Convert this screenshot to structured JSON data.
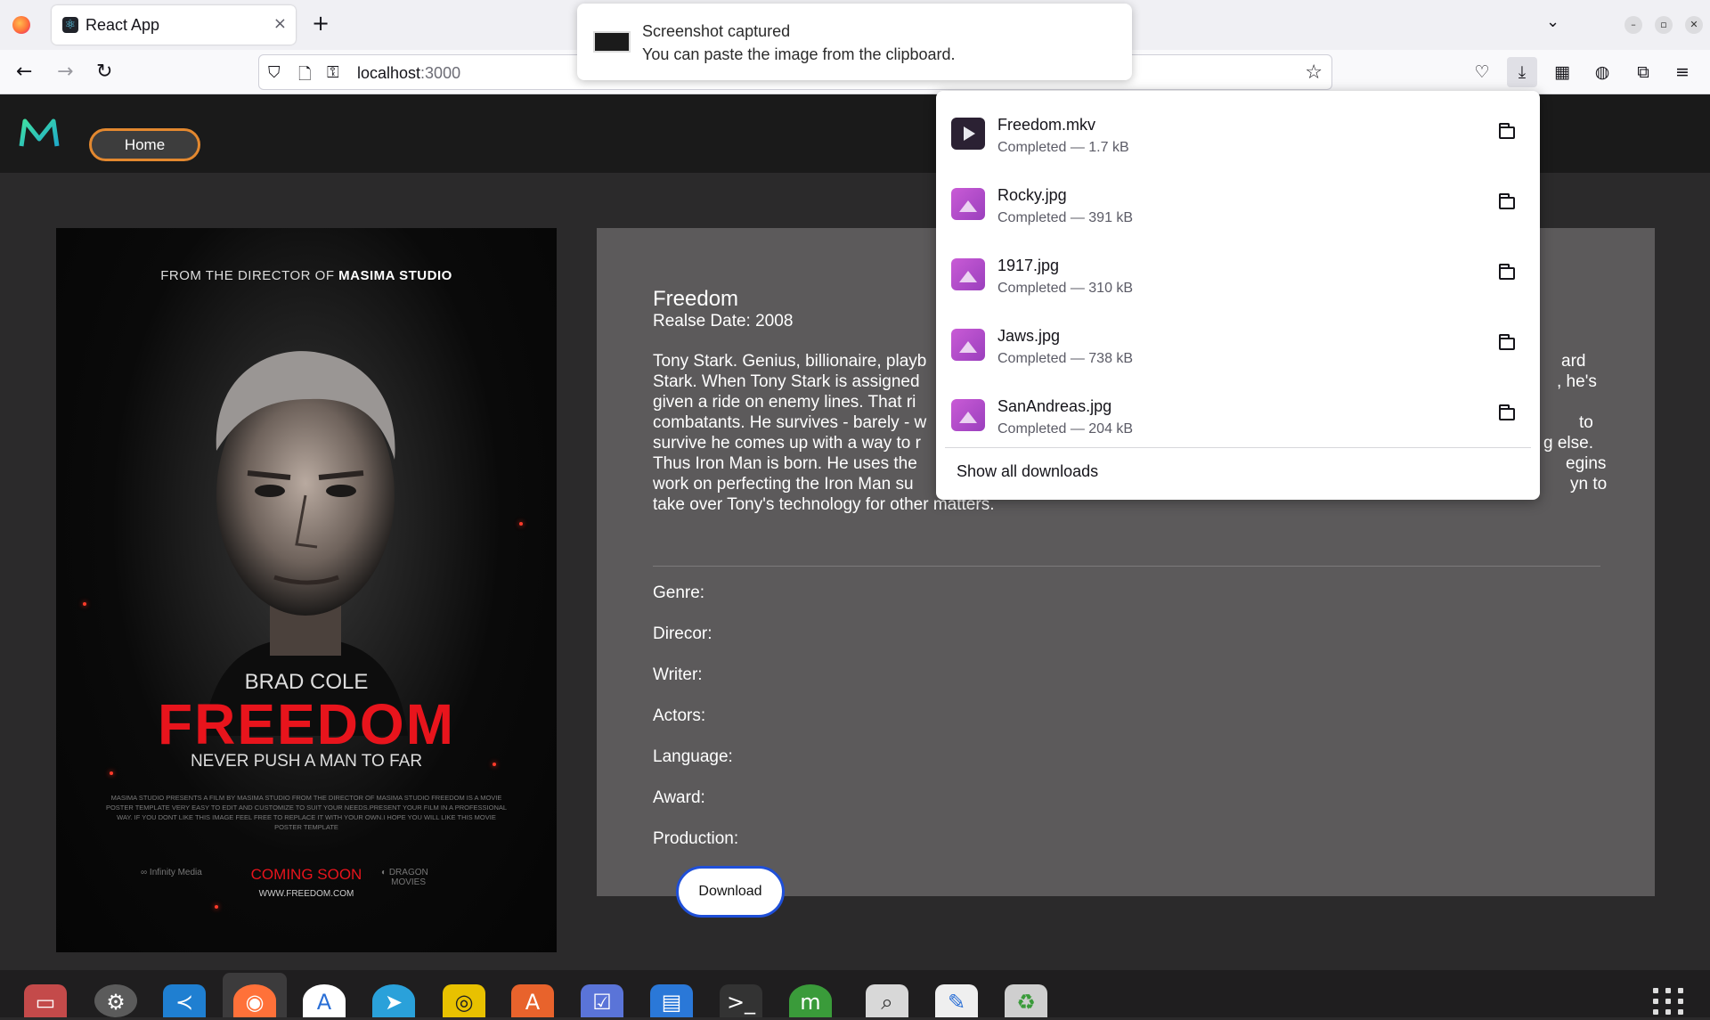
{
  "browser": {
    "tab_title": "React App",
    "tab_close": "×",
    "new_tab": "+",
    "url_host": "localhost",
    "url_port": ":3000"
  },
  "notification": {
    "title": "Screenshot captured",
    "body": "You can paste the image from the clipboard."
  },
  "app": {
    "home_label": "Home",
    "poster": {
      "top_line_prefix": "FROM THE DIRECTOR OF ",
      "top_line_studio": "MASIMA STUDIO",
      "actor": "BRAD COLE",
      "title": "FREEDOM",
      "tagline": "NEVER PUSH A MAN TO FAR",
      "fine_print": "MASIMA STUDIO PRESENTS A FILM BY MASIMA STUDIO FROM THE DIRECTOR OF MASIMA STUDIO FREEDOM IS A MOVIE POSTER TEMPLATE VERY EASY TO EDIT AND CUSTOMIZE TO SUIT YOUR NEEDS.PRESENT YOUR FILM IN A PROFESSIONAL WAY. IF YOU DONT LIKE THIS IMAGE FEEL FREE TO REPLACE IT WITH YOUR OWN.I HOPE YOU WILL LIKE THIS MOVIE POSTER TEMPLATE",
      "brand_left": "Infinity Media",
      "coming_soon": "COMING SOON",
      "brand_right_1": "DRAGON",
      "brand_right_2": "MOVIES",
      "website": "WWW.FREEDOM.COM"
    },
    "movie": {
      "title": "Freedom",
      "release": "Realse Date: 2008",
      "description": "Tony Stark. Genius, billionaire, playb…ard Stark. When Tony Stark is assigned …, he's given a ride on enemy lines. That ri… combatants. He survives - barely - w…to survive he comes up with a way to r…g else. Thus Iron Man is born. He uses the …egins work on perfecting the Iron Man su…yn to take over Tony's technology for other matters.",
      "desc_lines": [
        "Tony Stark. Genius, billionaire, playb",
        "ard",
        "Stark. When Tony Stark is assigned",
        ", he's",
        "given a ride on enemy lines. That ri",
        "combatants. He survives - barely - w",
        "to",
        "survive he comes up with a way to r",
        "g else.",
        "Thus Iron Man is born. He uses the",
        "egins",
        "work on perfecting the Iron Man su",
        "yn to",
        "take over Tony's technology for other matters."
      ],
      "fields": [
        "Genre:",
        "Direcor:",
        "Writer:",
        "Actors:",
        "Language:",
        "Award:",
        "Production:"
      ],
      "download_label": "Download"
    }
  },
  "downloads": {
    "items": [
      {
        "name": "Freedom.mkv",
        "status": "Completed — 1.7 kB",
        "kind": "video"
      },
      {
        "name": "Rocky.jpg",
        "status": "Completed — 391 kB",
        "kind": "image"
      },
      {
        "name": "1917.jpg",
        "status": "Completed — 310 kB",
        "kind": "image"
      },
      {
        "name": "Jaws.jpg",
        "status": "Completed — 738 kB",
        "kind": "image"
      },
      {
        "name": "SanAndreas.jpg",
        "status": "Completed — 204 kB",
        "kind": "image"
      }
    ],
    "show_all": "Show all downloads"
  },
  "dock": {
    "apps": [
      "files-icon",
      "settings-icon",
      "vscode-icon",
      "firefox-icon",
      "android-studio-icon",
      "telegram-icon",
      "rhythmbox-icon",
      "app-center-icon",
      "tasks-icon",
      "writer-icon",
      "terminal-icon",
      "mongodb-compass-icon",
      "image-viewer-icon",
      "text-editor-icon",
      "trash-icon"
    ]
  },
  "colors": {
    "accent_orange": "#e3882f",
    "poster_red": "#e8141c",
    "download_border": "#1f4fd8",
    "info_panel": "#5c5a5b",
    "page_bg": "#2b2a2b"
  }
}
